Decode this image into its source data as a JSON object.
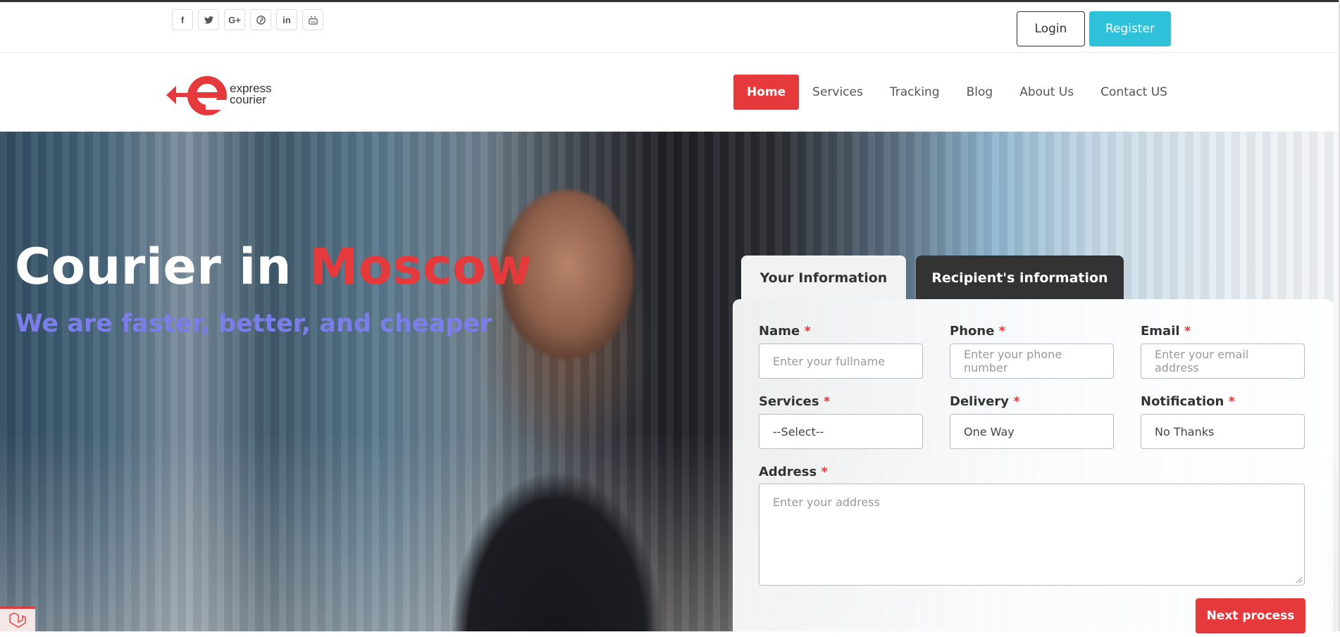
{
  "topbar": {
    "socials": [
      {
        "icon": "facebook-icon",
        "glyph": "f"
      },
      {
        "icon": "twitter-icon",
        "glyph": "🐦"
      },
      {
        "icon": "google-plus-icon",
        "glyph": "G+"
      },
      {
        "icon": "pinterest-icon",
        "glyph": "℗"
      },
      {
        "icon": "linkedin-icon",
        "glyph": "in"
      },
      {
        "icon": "youtube-icon",
        "glyph": "▶"
      }
    ],
    "login_label": "Login",
    "register_label": "Register"
  },
  "logo": {
    "line1": "express",
    "line2": "courier",
    "brand_color": "#e5393b"
  },
  "nav": {
    "items": [
      "Home",
      "Services",
      "Tracking",
      "Blog",
      "About Us",
      "Contact US"
    ],
    "active": "Home"
  },
  "hero": {
    "title_prefix": "Courier in ",
    "title_accent": "Moscow",
    "subtitle": "We are faster, better, and cheaper"
  },
  "form": {
    "tabs": [
      "Your Information",
      "Recipient's information"
    ],
    "required_mark": "*",
    "name": {
      "label": "Name",
      "placeholder": "Enter your fullname"
    },
    "phone": {
      "label": "Phone",
      "placeholder": "Enter your phone number"
    },
    "email": {
      "label": "Email",
      "placeholder": "Enter your email address"
    },
    "services": {
      "label": "Services",
      "value": "--Select--"
    },
    "delivery": {
      "label": "Delivery",
      "value": "One Way"
    },
    "notification": {
      "label": "Notification",
      "value": "No Thanks"
    },
    "address": {
      "label": "Address",
      "placeholder": "Enter your address"
    },
    "next_label": "Next process"
  },
  "colors": {
    "accent": "#e5393b",
    "register": "#2ec1d9",
    "subtitle": "#7b7ee8",
    "tab_dark": "#333333"
  }
}
